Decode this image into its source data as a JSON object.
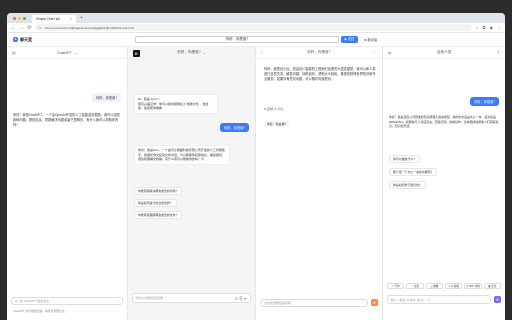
{
  "browser": {
    "tab_title": "Simple Chat Hub",
    "tab_close": "×",
    "new_tab": "+",
    "url": "chrome-extension://dpflgaeekmmimakgejjjkhjnfjhmhfj/chat-hub.html",
    "nav": {
      "back": "←",
      "forward": "→",
      "reload": "⟳"
    },
    "traffic": [
      "#ff5f57",
      "#febc2e",
      "#28c840"
    ]
  },
  "app": {
    "logo_text": "聊天室",
    "logo_mark": "S",
    "top_input_value": "你好，你是谁?",
    "send_label": "▶ 发送",
    "new_conv_label": "⊕ 新对话"
  },
  "col1": {
    "title": "ChatGPT",
    "user_msg": "你好，你是谁?",
    "bot_msg": "你好！我是ChatGPT，一个由OpenAI开发的人工智能语言模型。我可以回答各种问题、提供信息、帮助解决问题或者只是聊天。有什么我可以帮助你的吗?",
    "input_placeholder": "给\"ChatGPT\"发送消息",
    "footer": "ChatGPT 也可能会犯错。请核查重要信息。"
  },
  "col2": {
    "logo": "K",
    "title": "你好，你是谁?",
    "greeting": "Hi，我是 Kimi～\n很高兴遇见你！你可以随时把网址🔗或者文件📄发给我，我来帮你看看",
    "user_msg": "你好，你是谁?",
    "bot_msg": "你好！我是Kimi，一个由月之暗面科技有限公司开发的人工智能助手。我擅长中文和英文的对话，可以帮助你获取信息、解答疑问、阅读和理解文档等。有什么我可以帮助你的吗？😊",
    "suggestions": [
      "你能帮我解决哪些类型的问题？",
      "你是如何进行信息搜索的？",
      "你能帮我理解哪些类型的文件？"
    ],
    "input_placeholder": "你可以问我任何问题"
  },
  "col3": {
    "title": "你好，你是谁?",
    "bot_msg": "你好，我是百小应，是由百川智能的工程师们创造的大语言模型。我可以和人类进行自然交流、解答问题、协助创作，帮助大众轻松、普惠的获得世界知识和专业服务。如果你有任何问题，可以随时向我提问。",
    "copy_label": "⧉ 复制 ↺ 分享",
    "user_msg": "你好，你是谁?",
    "input_placeholder": "点击发送按钮提问吧",
    "send_icon": "➤"
  },
  "col4": {
    "title": "自我介绍",
    "user_msg": "你好，你是谁?",
    "bot_msg": "你好！我是百度公司研发的知识增强大语言模型，我的中文名是文心一言，英文名是ERNIE Bot。我能够与人对话互动，回答问题，协助创作，高效便捷地帮助人们获取信息、知识和灵感。",
    "suggestions": [
      "你可以做些什么？",
      "能介绍一下文心一言的功能吗？",
      "你是如何学习知识的？"
    ],
    "tools": [
      "✍ 写作",
      "☆ 绘画",
      "◷ 图像",
      "✎ AI 编辑",
      "⎙ PDF 转换",
      "▦ 更多"
    ],
    "input_placeholder": "输入 / 换出 AI 指令 或 @ 一下",
    "send_icon": "➤"
  }
}
